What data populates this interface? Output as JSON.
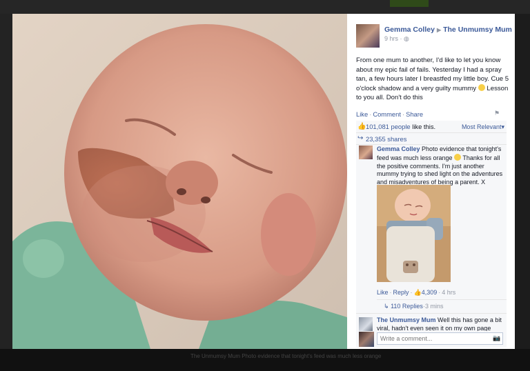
{
  "background": {
    "footer_text": "The Unmumsy Mum Photo evidence that tonight's feed was much less orange"
  },
  "close": {
    "glyph": "×"
  },
  "post": {
    "author": "Gemma Colley",
    "arrow": "▶",
    "page": "The Unmumsy Mum",
    "time": "9 hrs",
    "privacy_glyph": "◍",
    "text_before_emoji": "From one mum to another, I'd like to let you know about my epic fail of fails. Yesterday I had a spray tan, a few hours later I breastfed my little boy. Cue 5 o'clock shadow and a very guilty mummy ",
    "text_after_emoji": " Lesson to you all. Don't do this",
    "actions": {
      "like": "Like",
      "comment": "Comment",
      "share": "Share",
      "separator": "·"
    },
    "flag_glyph": "⚑"
  },
  "stats": {
    "like_icon": "👍",
    "likes_count": "101,081 people",
    "likes_suffix": " like this.",
    "sort": "Most Relevant",
    "sort_caret": "▾",
    "share_icon": "↪",
    "shares": "23,355 shares"
  },
  "comments": [
    {
      "author": "Gemma Colley",
      "text_before_emoji": " Photo evidence that tonight's feed was much less orange ",
      "text_after_emoji": " Thanks for all the positive comments. I'm just another mummy trying to shed light on the adventures and misadventures of being a parent. X",
      "actions": {
        "like": "Like",
        "reply": "Reply",
        "like_icon": "👍",
        "like_count": "4,309",
        "time": "4 hrs",
        "separator": "·"
      },
      "replies": {
        "arrow": "↳",
        "label": "110 Replies",
        "time": "3 mins",
        "separator": "·"
      }
    },
    {
      "author": "The Unmumsy Mum",
      "text": " Well this has gone a bit viral, hadn't even seen it on my own page"
    }
  ],
  "composer": {
    "placeholder": "Write a comment...",
    "camera_glyph": "📷"
  }
}
